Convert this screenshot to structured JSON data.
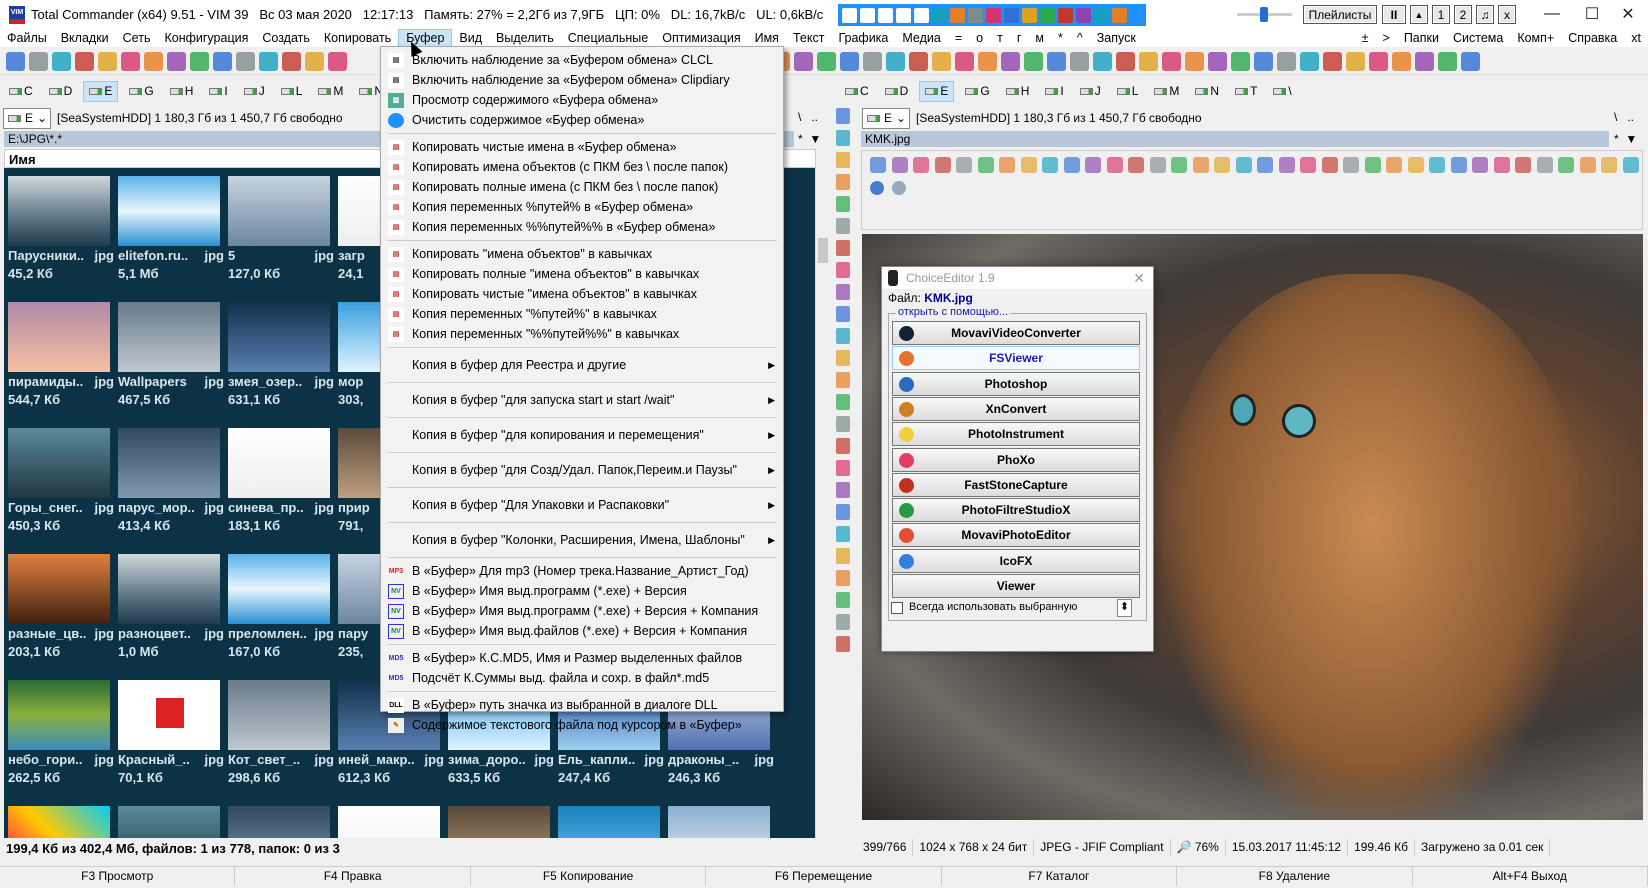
{
  "titlebar": {
    "icon_text": "VIM",
    "title": "Total Commander (x64) 9.51 - VIM 39   Вс 03 мая 2020   12:17:13   Память: 27% = 2,2Гб из 7,9ГБ   ЦП: 0%   DL: 16,7kB/c   UL: 0,6kB/c",
    "playlists": "Плейлисты",
    "pause": "II",
    "up": "▲",
    "btn1": "1",
    "btn2": "2",
    "note": "♫",
    "x": "x",
    "minimize": "—",
    "maximize": "☐",
    "close": "✕"
  },
  "menubar": {
    "items": [
      "Файлы",
      "Вкладки",
      "Сеть",
      "Конфигурация",
      "Создать",
      "Копировать",
      "Буфер",
      "Вид",
      "Выделить",
      "Специальные",
      "Оптимизация",
      "Имя",
      "Текст",
      "Графика",
      "Медиа",
      "=",
      "о",
      "т",
      "г",
      "м",
      "*",
      "^",
      "Запуск"
    ],
    "right": [
      "±",
      ">",
      "Папки",
      "Система",
      "Комп+",
      "Справка",
      "xt"
    ],
    "open_item": "Буфер"
  },
  "left_drives": [
    "C",
    "D",
    "E",
    "G",
    "H",
    "I",
    "J",
    "L",
    "M",
    "N"
  ],
  "right_drives": [
    "C",
    "D",
    "E",
    "G",
    "H",
    "I",
    "J",
    "L",
    "M",
    "N",
    "T",
    "\\"
  ],
  "selected_drive": "E",
  "left_panel": {
    "drive": "E",
    "free": "[SeaSystemHDD]  1 180,3 Гб из 1 450,7 Гб свободно",
    "path": "E:\\JPG\\*.*",
    "column": "Имя",
    "nav": "\\   ..",
    "sort": "*  ▼",
    "thumbs": [
      [
        {
          "n": "Парусники..",
          "e": "jpg",
          "s": "45,2 Кб"
        },
        {
          "n": "elitefon.ru..",
          "e": "jpg",
          "s": "5,1 Мб"
        },
        {
          "n": "5",
          "e": "jpg",
          "s": "127,0 Кб"
        },
        {
          "n": "загр",
          "e": "",
          "s": "24,1"
        }
      ],
      [
        {
          "n": "пирамиды..",
          "e": "jpg",
          "s": "544,7 Кб"
        },
        {
          "n": "Wallpapers",
          "e": "jpg",
          "s": "467,5 Кб"
        },
        {
          "n": "змея_озер..",
          "e": "jpg",
          "s": "631,1 Кб"
        },
        {
          "n": "мор",
          "e": "",
          "s": "303,"
        }
      ],
      [
        {
          "n": "Горы_снег..",
          "e": "jpg",
          "s": "450,3 Кб"
        },
        {
          "n": "парус_мор..",
          "e": "jpg",
          "s": "413,4 Кб"
        },
        {
          "n": "синева_пр..",
          "e": "jpg",
          "s": "183,1 Кб"
        },
        {
          "n": "прир",
          "e": "",
          "s": "791,"
        }
      ],
      [
        {
          "n": "разные_цв..",
          "e": "jpg",
          "s": "203,1 Кб"
        },
        {
          "n": "разноцвет..",
          "e": "jpg",
          "s": "1,0 Мб"
        },
        {
          "n": "преломлен..",
          "e": "jpg",
          "s": "167,0 Кб"
        },
        {
          "n": "пару",
          "e": "",
          "s": "235,"
        }
      ],
      [
        {
          "n": "небо_гори..",
          "e": "jpg",
          "s": "262,5 Кб"
        },
        {
          "n": "Красный_..",
          "e": "jpg",
          "s": "70,1 Кб"
        },
        {
          "n": "Кот_свет_..",
          "e": "jpg",
          "s": "298,6 Кб"
        },
        {
          "n": "иней_макр..",
          "e": "jpg",
          "s": "612,3 Кб"
        },
        {
          "n": "зима_доро..",
          "e": "jpg",
          "s": "633,5 Кб"
        },
        {
          "n": "Ель_капли..",
          "e": "jpg",
          "s": "247,4 Кб"
        },
        {
          "n": "драконы_..",
          "e": "jpg",
          "s": "246,3 Кб"
        }
      ]
    ],
    "status": "199,4 Кб из 402,4 Мб, файлов: 1 из 778, папок: 0 из 3"
  },
  "right_panel": {
    "drive": "E",
    "free": "[SeaSystemHDD]  1 180,3 Гб из 1 450,7 Гб свободно",
    "path": "KMK.jpg",
    "nav": "\\   ..",
    "sort": "*  ▼",
    "status": [
      "399/766",
      "1024 x 768 x 24 бит",
      "JPEG - JFIF Compliant",
      "🔎 76%",
      "15.03.2017 11:45:12",
      "199.46 Кб",
      "Загружено за 0.01 сек"
    ]
  },
  "menu": [
    {
      "icon": "clipboard",
      "label": "Включить наблюдение за «Буфером обмена» CLCL"
    },
    {
      "icon": "clipboard",
      "label": "Включить наблюдение за «Буфером обмена» Clipdiary"
    },
    {
      "icon": "view",
      "label": "Просмотр содержимого «Буфера обмена»"
    },
    {
      "icon": "circle",
      "label": "Очистить содержимое «Буфер обмена»"
    },
    {
      "sep": true
    },
    {
      "icon": "doc",
      "label": "Копировать чистые имена в «Буфер обмена»"
    },
    {
      "icon": "doc",
      "label": "Копировать имена объектов (с ПКМ без \\ после папок)"
    },
    {
      "icon": "doc",
      "label": "Копировать полные имена (с ПКМ без \\ после папок)"
    },
    {
      "icon": "doc",
      "label": "Копия переменных %путей% в «Буфер обмена»"
    },
    {
      "icon": "doc",
      "label": "Копия переменных %%путей%% в «Буфер обмена»"
    },
    {
      "sep": true
    },
    {
      "icon": "doc",
      "label": "Копировать \"имена объектов\" в кавычках"
    },
    {
      "icon": "doc",
      "label": "Копировать полные \"имена объектов\" в кавычках"
    },
    {
      "icon": "doc",
      "label": "Копировать чистые \"имена объектов\" в кавычках"
    },
    {
      "icon": "doc",
      "label": "Копия переменных \"%путей%\" в кавычках"
    },
    {
      "icon": "doc",
      "label": "Копия переменных \"%%путей%%\" в кавычках"
    },
    {
      "sep": true
    },
    {
      "label": "Копия в буфер для Реестра и другие",
      "submenu": true
    },
    {
      "sep": true
    },
    {
      "label": "Копия в буфер \"для запуска start  и  start /wait\"",
      "submenu": true
    },
    {
      "sep": true
    },
    {
      "label": "Копия в буфер \"для копирования и перемещения\"",
      "submenu": true
    },
    {
      "sep": true
    },
    {
      "label": "Копия в буфер \"для Созд/Удал. Папок,Переим.и Паузы\"",
      "submenu": true
    },
    {
      "sep": true
    },
    {
      "label": "Копия в буфер \"Для Упаковки и Распаковки\"",
      "submenu": true
    },
    {
      "sep": true
    },
    {
      "label": "Копия в буфер \"Колонки, Расширения, Имена, Шаблоны\"",
      "submenu": true
    },
    {
      "sep": true
    },
    {
      "icon": "MP3",
      "label": "В «Буфер» Для mp3 (Номер трека.Название_Артист_Год)"
    },
    {
      "icon": "NV",
      "label": "В «Буфер» Имя выд.программ (*.exe) + Версия"
    },
    {
      "icon": "NV",
      "label": "В «Буфер» Имя выд.программ (*.exe) + Версия + Компания"
    },
    {
      "icon": "NV",
      "label": "В «Буфер» Имя выд.файлов (*.exe) + Версия + Компания"
    },
    {
      "sep": true
    },
    {
      "icon": "MD5",
      "label": "В «Буфер» К.С.MD5, Имя и Размер выделенных файлов"
    },
    {
      "icon": "MD5",
      "label": "Подсчёт К.Суммы выд. файла и сохр. в файл*.md5"
    },
    {
      "sep": true
    },
    {
      "icon": "DLL",
      "label": "В «Буфер» путь значка из выбранной в диалоге DLL"
    },
    {
      "icon": "txt",
      "label": "Содержимое текстового файла под курсором в «Буфер»"
    }
  ],
  "dialog": {
    "title": "ChoiceEditor 1.9",
    "file_label": "Файл:",
    "file": "KMK.jpg",
    "group": "открыть с помощью...",
    "close": "✕",
    "apps": [
      "MovaviVideoConverter",
      "FSViewer",
      "Photoshop",
      "XnConvert",
      "PhotoInstrument",
      "PhoXo",
      "FastStoneCapture",
      "PhotoFiltreStudioX",
      "MovaviPhotoEditor",
      "IcoFX",
      "Viewer"
    ],
    "highlighted": "FSViewer",
    "always": "Всегда использовать выбранную",
    "spin": "⬍"
  },
  "fkeys": [
    "F3 Просмотр",
    "F4 Правка",
    "F5 Копирование",
    "F6 Перемещение",
    "F7 Каталог",
    "F8 Удаление",
    "Alt+F4 Выход"
  ]
}
